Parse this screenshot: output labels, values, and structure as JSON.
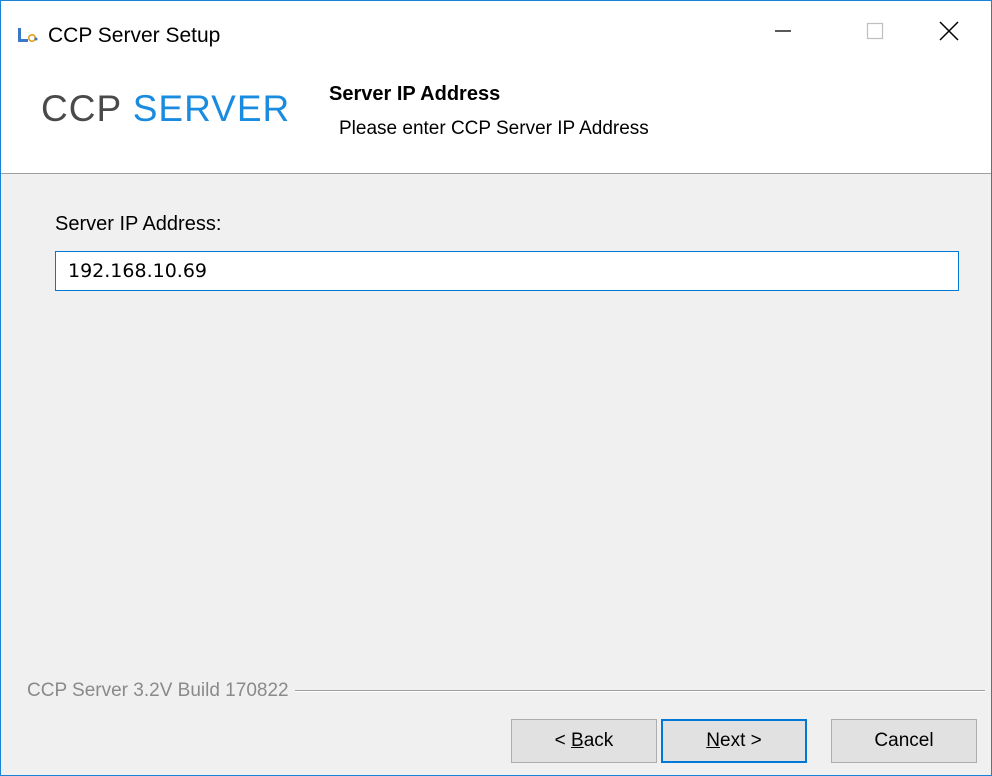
{
  "window": {
    "title": "CCP Server Setup",
    "icon": "installer-app-icon"
  },
  "header": {
    "logo_part1": "CCP",
    "logo_part2": "SERVER",
    "title": "Server IP Address",
    "subtitle": "Please enter CCP Server IP Address"
  },
  "form": {
    "label": "Server IP Address:",
    "ip_value": "192.168.10.69"
  },
  "footer": {
    "build_text": "CCP Server 3.2V Build 170822",
    "back_pre": "< ",
    "back_mnemonic": "B",
    "back_post": "ack",
    "next_mnemonic": "N",
    "next_post": "ext >",
    "cancel_label": "Cancel"
  },
  "colors": {
    "accent": "#0078d7",
    "logo_blue": "#1a8ce0",
    "logo_gray": "#4a4a4a",
    "window_border": "#1883d7"
  }
}
